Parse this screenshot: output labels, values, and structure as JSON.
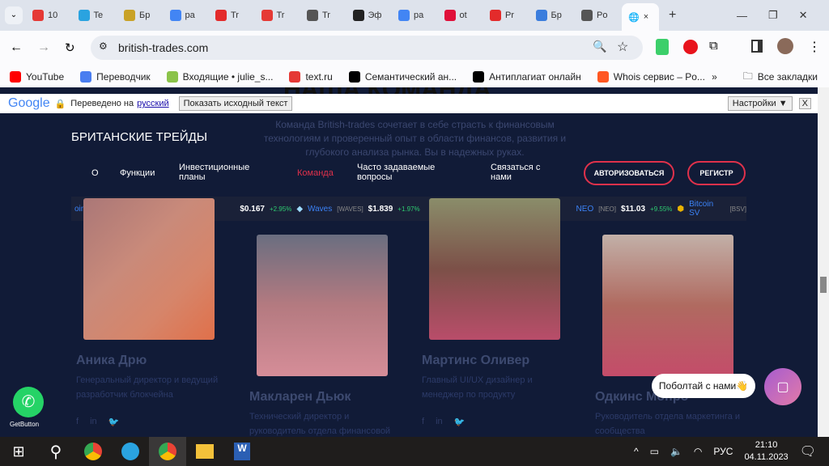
{
  "browser": {
    "tabs": [
      {
        "label": "10",
        "color": "#e53935"
      },
      {
        "label": "Te",
        "color": "#2aa3e0"
      },
      {
        "label": "Бр",
        "color": "#c9a227"
      },
      {
        "label": "pa",
        "color": "#4285f4"
      },
      {
        "label": "Tr",
        "color": "#e32b2b"
      },
      {
        "label": "Tr",
        "color": "#e53935"
      },
      {
        "label": "Tr",
        "color": "#555"
      },
      {
        "label": "Эф",
        "color": "#222"
      },
      {
        "label": "pa",
        "color": "#4285f4"
      },
      {
        "label": "ot",
        "color": "#e0103a"
      },
      {
        "label": "Pr",
        "color": "#e32b2b"
      },
      {
        "label": "Бр",
        "color": "#3b7ddd"
      },
      {
        "label": "Po",
        "color": "#555"
      }
    ],
    "active_tab_close": "×",
    "new_tab": "+",
    "url": "british-trades.com",
    "bookmarks": [
      {
        "label": "YouTube",
        "color": "#ff0000"
      },
      {
        "label": "Переводчик",
        "color": "#4a7ef0"
      },
      {
        "label": "Входящие • julie_s...",
        "color": "#8bc34a"
      },
      {
        "label": "text.ru",
        "color": "#e53935"
      },
      {
        "label": "Семантический ан...",
        "color": "#000"
      },
      {
        "label": "Антиплагиат онлайн",
        "color": "#000"
      },
      {
        "label": "Whois сервис – Po...",
        "color": "#ff5722"
      }
    ],
    "more_bookmarks": "»",
    "all_bookmarks": "Все закладки"
  },
  "translate_bar": {
    "logo": "Google",
    "translated_to": "Переведено на",
    "language": "русский",
    "show_original": "Показать исходный текст",
    "settings": "Настройки ▼",
    "close": "X"
  },
  "site": {
    "heading_partial": "НАША КОМАНДА",
    "intro": "Команда British-trades сочетает в себе страсть к финансовым технологиям и проверенный опыт в области финансов, развития и глубокого анализа рынка. Вы в надежных руках.",
    "brand": "БРИТАНСКИЕ ТРЕЙДЫ",
    "nav": [
      "О",
      "Функции",
      "Инвестиционные планы",
      "Команда",
      "Часто задаваемые вопросы",
      "Связаться с нами"
    ],
    "active_nav": "Команда",
    "login": "АВТОРИЗОВАТЬСЯ",
    "register": "РЕГИСТР",
    "ticker": [
      {
        "price": "$0.167",
        "change": "+2.95%"
      },
      {
        "name": "Waves",
        "sym": "[WAVES]",
        "price": "$1.839",
        "change": "+1.97%"
      },
      {
        "name": "NEO",
        "sym": "[NEO]",
        "price": "$11.03",
        "change": "+9.55%"
      },
      {
        "name": "Bitcoin SV",
        "sym": "[BSV]"
      }
    ],
    "ticker_partial": "oin",
    "team": [
      {
        "name": "Аника Дрю",
        "role": "Генеральный директор и ведущий разработчик блокчейна"
      },
      {
        "name": "Макларен Дьюк",
        "role": "Технический директор и руководитель отдела финансовой"
      },
      {
        "name": "Мартинс Оливер",
        "role": "Главный UI/UX дизайнер и менеджер по продукту"
      },
      {
        "name": "Одкинс Монро",
        "role": "Руководитель отдела маркетинга и сообщества"
      }
    ],
    "social": [
      "f",
      "in",
      "🐦"
    ],
    "chat_bubble": "Поболтай с нами👋",
    "getbutton": "GetButton"
  },
  "taskbar": {
    "lang": "РУС",
    "time": "21:10",
    "date": "04.11.2023"
  },
  "colors": {
    "accent": "#e0314b",
    "page_bg": "#111b37",
    "up": "#2ecc71"
  }
}
